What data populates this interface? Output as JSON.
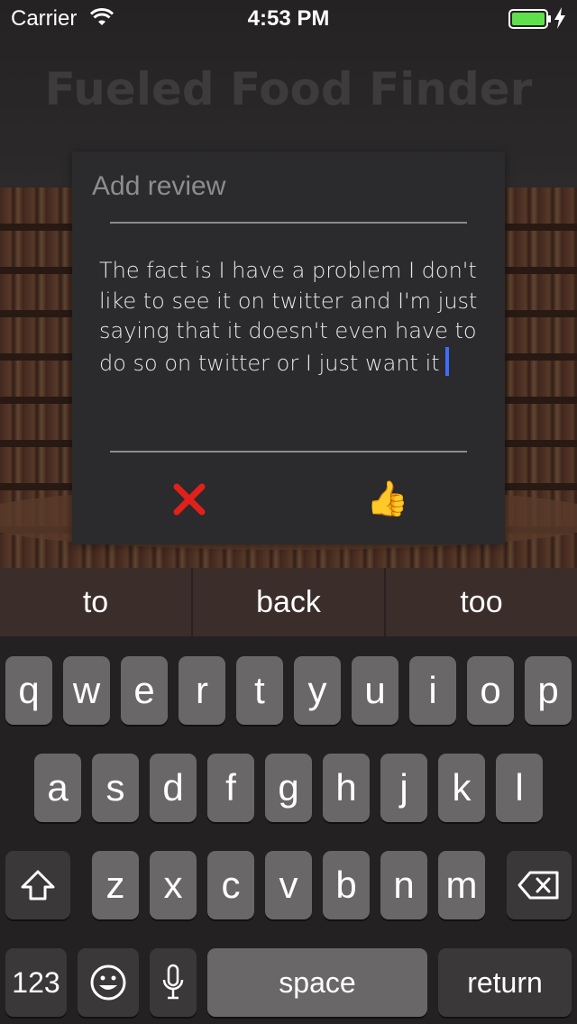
{
  "status_bar": {
    "carrier": "Carrier",
    "time": "4:53 PM"
  },
  "app": {
    "title": "Fueled Food Finder"
  },
  "modal": {
    "title": "Add review",
    "review_text": "The fact is I have a problem I don't like to see it on twitter and I'm just saying that it doesn't even have to do so on twitter or I just want it",
    "cancel_icon": "red-x-icon",
    "approve_icon": "thumbs-up-icon",
    "approve_glyph": "👍"
  },
  "keyboard": {
    "suggestions": [
      "to",
      "back",
      "too"
    ],
    "row1": [
      "q",
      "w",
      "e",
      "r",
      "t",
      "y",
      "u",
      "i",
      "o",
      "p"
    ],
    "row2": [
      "a",
      "s",
      "d",
      "f",
      "g",
      "h",
      "j",
      "k",
      "l"
    ],
    "row3": [
      "z",
      "x",
      "c",
      "v",
      "b",
      "n",
      "m"
    ],
    "numbers_label": "123",
    "space_label": "space",
    "return_label": "return"
  },
  "colors": {
    "caret": "#3d6eff",
    "cancel": "#e0201b",
    "battery": "#5ee04a"
  }
}
